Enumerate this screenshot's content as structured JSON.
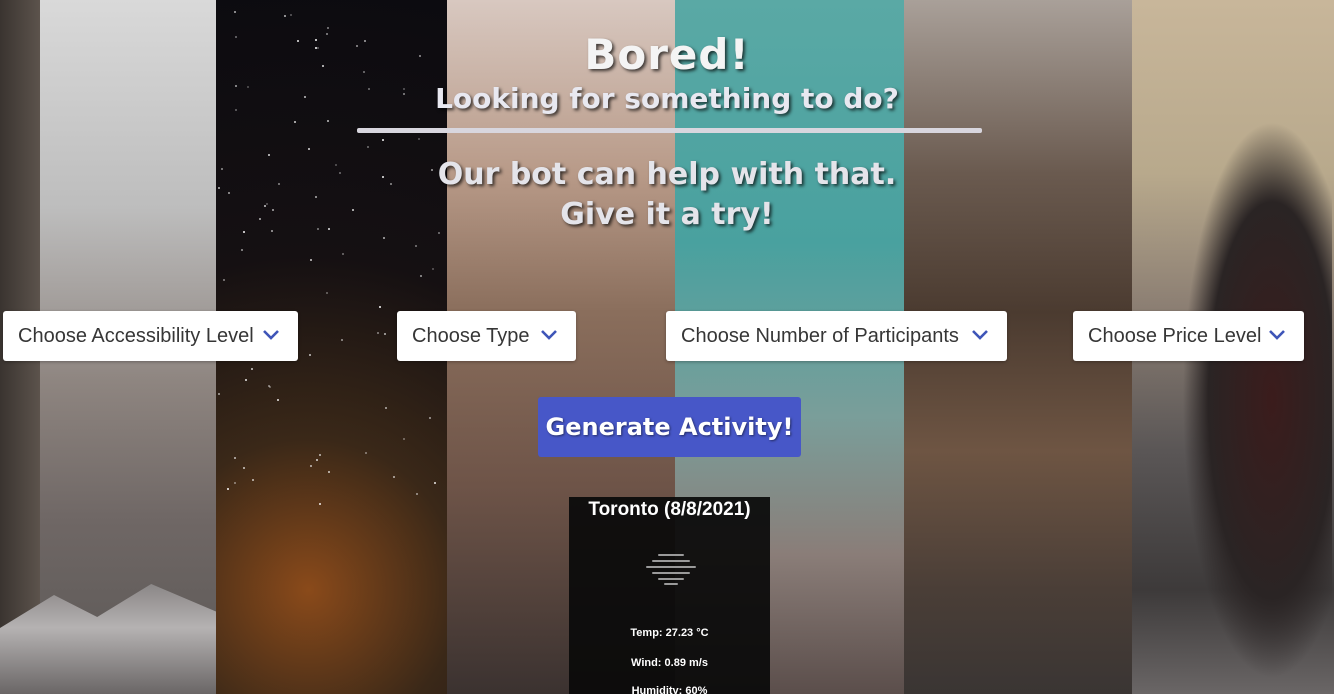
{
  "hero": {
    "title": "Bored!",
    "subtitle": "Looking for something to do?",
    "tagline_line1": "Our bot can help with that.",
    "tagline_line2": "Give it a try!"
  },
  "filters": {
    "accessibility": "Choose Accessibility Level",
    "type": "Choose Type",
    "participants": "Choose Number of Participants",
    "price": "Choose Price Level"
  },
  "generate_button": "Generate Activity!",
  "weather": {
    "city": "Toronto (8/8/2021)",
    "icon": "fog-icon",
    "temp": "Temp: 27.23 °C",
    "wind": "Wind: 0.89 m/s",
    "humidity": "Humidity: 60%"
  },
  "colors": {
    "button": "#4757c8",
    "chevron": "#3e55b8"
  }
}
